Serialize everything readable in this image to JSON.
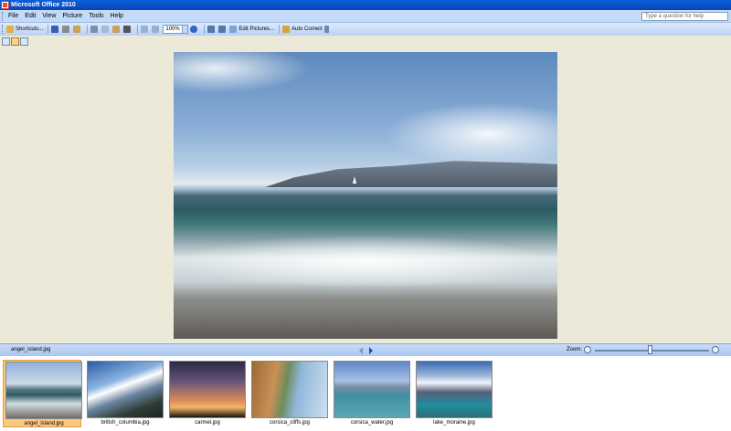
{
  "window": {
    "title": "Microsoft Office 2010"
  },
  "menu": {
    "items": [
      "File",
      "Edit",
      "View",
      "Picture",
      "Tools",
      "Help"
    ],
    "help_placeholder": "Type a question for help"
  },
  "toolbar": {
    "shortcuts_label": "Shortcuts...",
    "zoom_value": "100%",
    "edit_pictures_label": "Edit Pictures...",
    "auto_correct_label": "Auto Correct"
  },
  "status": {
    "current_file": "angel_island.jpg",
    "zoom_label": "Zoom:",
    "zoom_level": 0.48
  },
  "filmstrip": {
    "thumbnails": [
      {
        "caption": "angel_island.jpg",
        "selected": true
      },
      {
        "caption": "british_columbia.jpg",
        "selected": false
      },
      {
        "caption": "carmel.jpg",
        "selected": false
      },
      {
        "caption": "corsica_cliffs.jpg",
        "selected": false
      },
      {
        "caption": "corsica_water.jpg",
        "selected": false
      },
      {
        "caption": "lake_moraine.jpg",
        "selected": false
      }
    ]
  },
  "colors": {
    "titlebar": "#0a5fd8",
    "menubar": "#c3daf9",
    "selection": "#f9c883"
  }
}
